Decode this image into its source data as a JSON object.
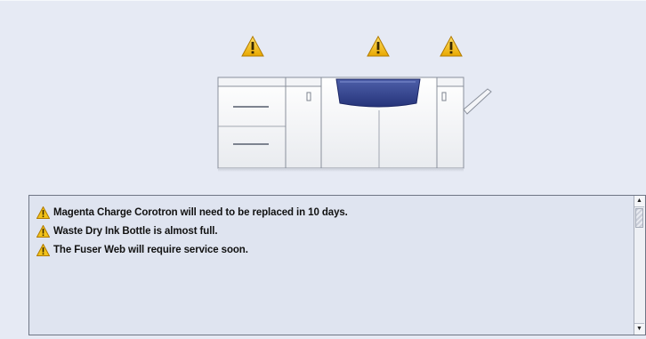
{
  "device": {
    "warning_indicators": [
      "warning-icon",
      "warning-icon",
      "warning-icon"
    ]
  },
  "messages": {
    "items": [
      {
        "icon": "warning-icon",
        "text": "Magenta Charge Corotron will need to be replaced in 10 days."
      },
      {
        "icon": "warning-icon",
        "text": "Waste Dry Ink Bottle is almost full."
      },
      {
        "icon": "warning-icon",
        "text": "The Fuser Web will require service soon."
      }
    ]
  },
  "colors": {
    "background": "#e6eaf4",
    "warning_yellow": "#f2c21a",
    "accent_blue": "#2f3f8e"
  }
}
